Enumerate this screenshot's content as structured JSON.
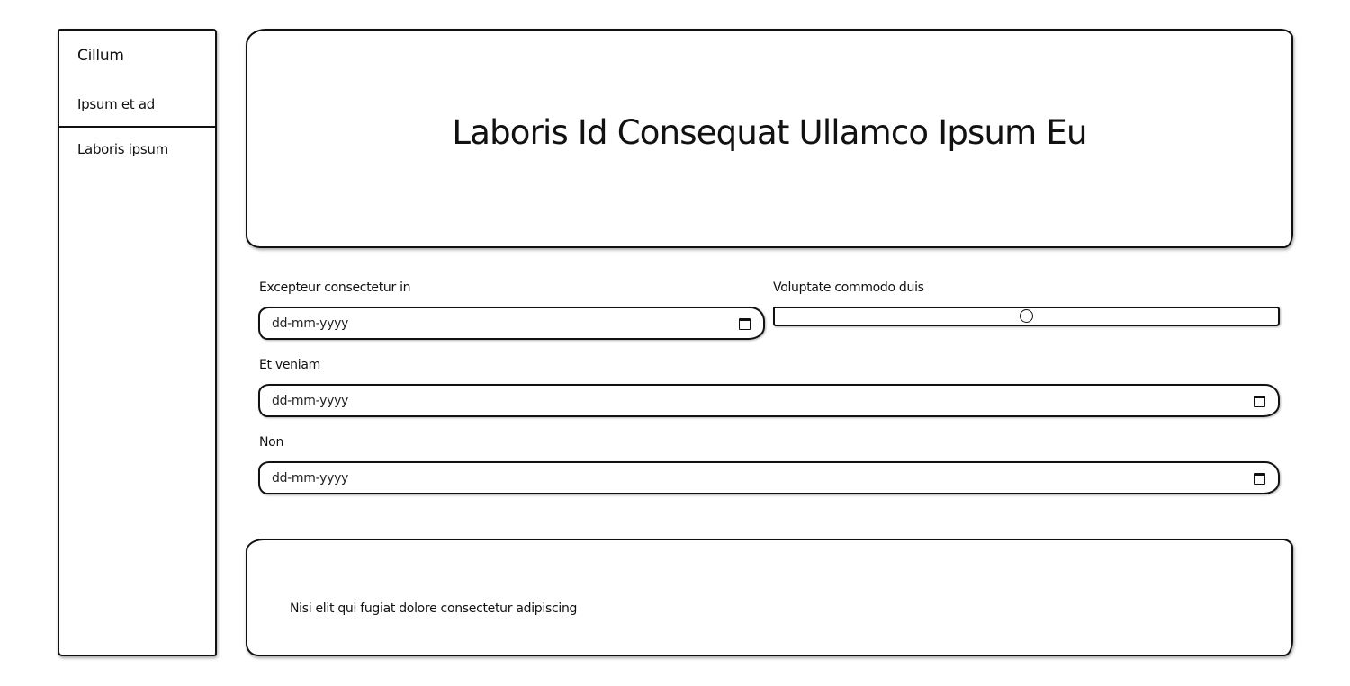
{
  "sidebar": {
    "title": "Cillum",
    "items": [
      {
        "label": "Ipsum et ad"
      },
      {
        "label": "Laboris ipsum"
      }
    ]
  },
  "hero": {
    "title": "Laboris Id Consequat Ullamco Ipsum Eu"
  },
  "form": {
    "field1": {
      "label": "Excepteur consectetur in",
      "placeholder": "dd-mm-yyyy"
    },
    "slider": {
      "label": "Voluptate commodo duis",
      "value_fraction": 0.5
    },
    "field2": {
      "label": "Et veniam",
      "placeholder": "dd-mm-yyyy"
    },
    "field3": {
      "label": "Non",
      "placeholder": "dd-mm-yyyy"
    }
  },
  "footer": {
    "text": "Nisi elit qui fugiat dolore consectetur adipiscing"
  },
  "icons": {
    "calendar": "calendar-icon"
  }
}
